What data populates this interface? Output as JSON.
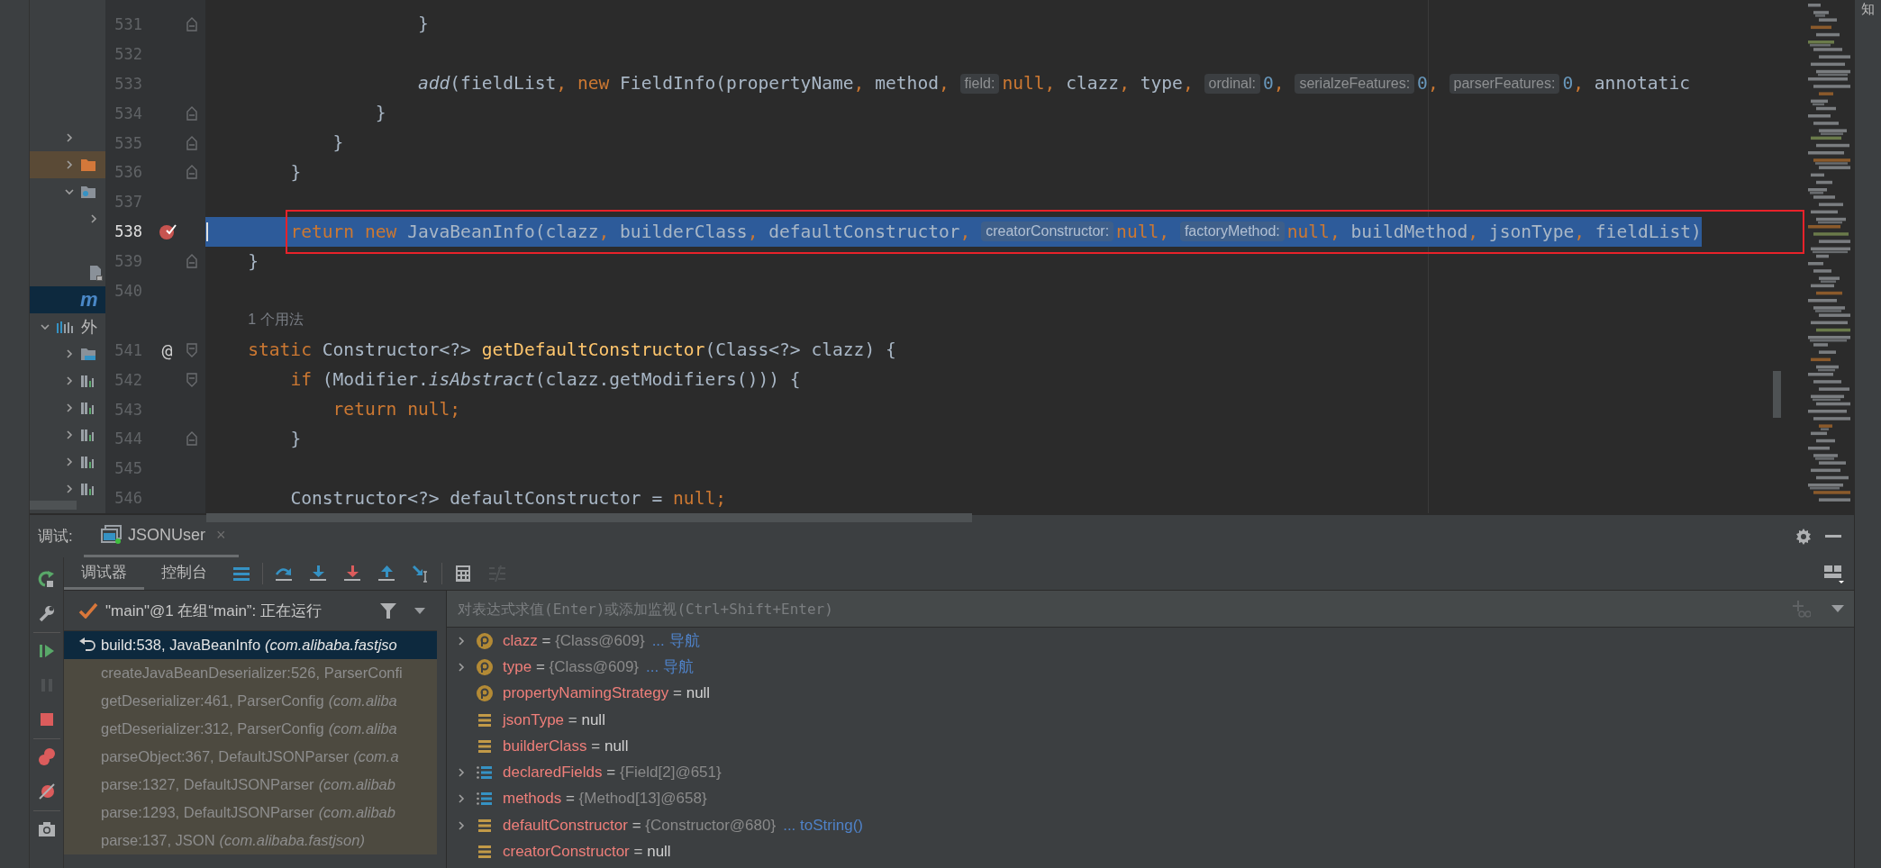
{
  "right_strip": {
    "label": "知"
  },
  "project_tree": {
    "items": [
      {
        "kind": "none",
        "expanded": false,
        "highlighted": false,
        "selected": false
      },
      {
        "kind": "folder-orange",
        "expanded": false,
        "highlighted": true,
        "selected": false
      },
      {
        "kind": "folder-dot",
        "expanded": true,
        "highlighted": false,
        "selected": false,
        "children": [
          {
            "kind": "none",
            "expanded": false,
            "highlighted": false,
            "selected": false
          },
          {
            "kind": "blank",
            "highlighted": false,
            "selected": false
          },
          {
            "kind": "file",
            "highlighted": false,
            "selected": false
          }
        ]
      },
      {
        "kind": "module",
        "label": "m",
        "highlighted": false,
        "selected": true
      }
    ],
    "external": {
      "label": "外",
      "expanded": true,
      "children": [
        {
          "kind": "folder-blue",
          "expanded": false
        },
        {
          "kind": "library",
          "expanded": false
        },
        {
          "kind": "library",
          "expanded": false
        },
        {
          "kind": "library",
          "expanded": false
        },
        {
          "kind": "library",
          "expanded": false
        },
        {
          "kind": "library",
          "expanded": false
        }
      ]
    }
  },
  "editor": {
    "lines": [
      {
        "kind": "code",
        "number": "531",
        "fold": {
          "kind": "end"
        },
        "current": false,
        "selected": false,
        "boxed": false,
        "tokens": [
          {
            "text": "                    }",
            "kind": "id"
          }
        ]
      },
      {
        "kind": "code",
        "number": "532",
        "current": false,
        "selected": false,
        "boxed": false
      },
      {
        "kind": "code",
        "number": "533",
        "current": false,
        "selected": false,
        "boxed": false,
        "tokens": [
          {
            "text": "                    add",
            "kind": "italic"
          },
          {
            "text": "(fieldList",
            "kind": "id"
          },
          {
            "text": ", ",
            "kind": "punct"
          },
          {
            "text": "new ",
            "kind": "kw"
          },
          {
            "text": "FieldInfo(propertyName",
            "kind": "id"
          },
          {
            "text": ", ",
            "kind": "punct"
          },
          {
            "text": "method",
            "kind": "id"
          },
          {
            "text": ", ",
            "kind": "punct"
          },
          {
            "text": "field:",
            "kind": "hint"
          },
          {
            "text": "null",
            "kind": "kw"
          },
          {
            "text": ", ",
            "kind": "punct"
          },
          {
            "text": "clazz",
            "kind": "id"
          },
          {
            "text": ", ",
            "kind": "punct"
          },
          {
            "text": "type",
            "kind": "id"
          },
          {
            "text": ", ",
            "kind": "punct"
          },
          {
            "text": "ordinal:",
            "kind": "hint"
          },
          {
            "text": "0",
            "kind": "num"
          },
          {
            "text": ", ",
            "kind": "punct"
          },
          {
            "text": "serialzeFeatures:",
            "kind": "hint"
          },
          {
            "text": "0",
            "kind": "num"
          },
          {
            "text": ", ",
            "kind": "punct"
          },
          {
            "text": "parserFeatures:",
            "kind": "hint"
          },
          {
            "text": "0",
            "kind": "num"
          },
          {
            "text": ", ",
            "kind": "punct"
          },
          {
            "text": "annotatic",
            "kind": "id"
          }
        ]
      },
      {
        "kind": "code",
        "number": "534",
        "fold": {
          "kind": "end"
        },
        "current": false,
        "selected": false,
        "boxed": false,
        "tokens": [
          {
            "text": "                }",
            "kind": "id"
          }
        ]
      },
      {
        "kind": "code",
        "number": "535",
        "fold": {
          "kind": "end"
        },
        "current": false,
        "selected": false,
        "boxed": false,
        "tokens": [
          {
            "text": "            }",
            "kind": "id"
          }
        ]
      },
      {
        "kind": "code",
        "number": "536",
        "fold": {
          "kind": "end"
        },
        "current": false,
        "selected": false,
        "boxed": false,
        "tokens": [
          {
            "text": "        }",
            "kind": "id"
          }
        ]
      },
      {
        "kind": "code",
        "number": "537",
        "current": false,
        "selected": false,
        "boxed": false
      },
      {
        "kind": "code",
        "number": "538",
        "marker": {
          "kind": "breakpoint"
        },
        "current": true,
        "selected": true,
        "boxed": true,
        "tokens": [
          {
            "text": "        return new ",
            "kind": "kw"
          },
          {
            "text": "JavaBeanInfo(clazz",
            "kind": "id"
          },
          {
            "text": ", ",
            "kind": "punct"
          },
          {
            "text": "builderClass",
            "kind": "id"
          },
          {
            "text": ", ",
            "kind": "punct"
          },
          {
            "text": "defaultConstructor",
            "kind": "id"
          },
          {
            "text": ", ",
            "kind": "punct"
          },
          {
            "text": "creatorConstructor:",
            "kind": "hint"
          },
          {
            "text": "null",
            "kind": "kw"
          },
          {
            "text": ", ",
            "kind": "punct"
          },
          {
            "text": "factoryMethod:",
            "kind": "hint"
          },
          {
            "text": "null",
            "kind": "kw"
          },
          {
            "text": ", ",
            "kind": "punct"
          },
          {
            "text": "buildMethod",
            "kind": "id"
          },
          {
            "text": ", ",
            "kind": "punct"
          },
          {
            "text": "jsonType",
            "kind": "id"
          },
          {
            "text": ", ",
            "kind": "punct"
          },
          {
            "text": "fieldList)",
            "kind": "id"
          }
        ]
      },
      {
        "kind": "code",
        "number": "539",
        "fold": {
          "kind": "end"
        },
        "current": false,
        "selected": false,
        "boxed": false,
        "tokens": [
          {
            "text": "    }",
            "kind": "id"
          }
        ]
      },
      {
        "kind": "code",
        "number": "540",
        "current": false,
        "selected": false,
        "boxed": false
      },
      {
        "kind": "usage",
        "tokens": [
          {
            "text": "    1 个用法",
            "kind": "usage"
          }
        ]
      },
      {
        "kind": "code",
        "number": "541",
        "marker": {
          "kind": "glyph",
          "text": "@"
        },
        "fold": {
          "kind": "start"
        },
        "current": false,
        "selected": false,
        "boxed": false,
        "tokens": [
          {
            "text": "    static ",
            "kind": "kw"
          },
          {
            "text": "Constructor<?> ",
            "kind": "id"
          },
          {
            "text": "getDefaultConstructor",
            "kind": "fn"
          },
          {
            "text": "(Class<?> clazz) {",
            "kind": "id"
          }
        ]
      },
      {
        "kind": "code",
        "number": "542",
        "fold": {
          "kind": "start"
        },
        "current": false,
        "selected": false,
        "boxed": false,
        "tokens": [
          {
            "text": "        if ",
            "kind": "kw"
          },
          {
            "text": "(Modifier.",
            "kind": "id"
          },
          {
            "text": "isAbstract",
            "kind": "italic"
          },
          {
            "text": "(clazz.getModifiers())) {",
            "kind": "id"
          }
        ]
      },
      {
        "kind": "code",
        "number": "543",
        "current": false,
        "selected": false,
        "boxed": false,
        "tokens": [
          {
            "text": "            return null",
            "kind": "kw"
          },
          {
            "text": ";",
            "kind": "punct"
          }
        ]
      },
      {
        "kind": "code",
        "number": "544",
        "fold": {
          "kind": "end"
        },
        "current": false,
        "selected": false,
        "boxed": false,
        "tokens": [
          {
            "text": "        }",
            "kind": "id"
          }
        ]
      },
      {
        "kind": "code",
        "number": "545",
        "current": false,
        "selected": false,
        "boxed": false
      },
      {
        "kind": "code",
        "number": "546",
        "current": false,
        "selected": false,
        "boxed": false,
        "tokens": [
          {
            "text": "        Constructor<?> defaultConstructor = ",
            "kind": "id"
          },
          {
            "text": "null",
            "kind": "kw"
          },
          {
            "text": ";",
            "kind": "punct"
          }
        ]
      }
    ]
  },
  "debug": {
    "label": "调试:",
    "session_tab": {
      "label": "JSONUser",
      "close": "×",
      "selected": true
    },
    "side_toolbar": [
      {
        "kind": "rerun",
        "disabled": false
      },
      {
        "kind": "settings",
        "disabled": false
      },
      {
        "kind": "separator",
        "disabled": false
      },
      {
        "kind": "resume",
        "disabled": false
      },
      {
        "kind": "pause",
        "disabled": true
      },
      {
        "kind": "stop",
        "disabled": false
      },
      {
        "kind": "separator",
        "disabled": false
      },
      {
        "kind": "breakpoints",
        "disabled": false
      },
      {
        "kind": "mute",
        "disabled": false
      },
      {
        "kind": "separator",
        "disabled": false
      },
      {
        "kind": "camera",
        "disabled": false
      }
    ],
    "tabs": [
      {
        "label": "调试器",
        "selected": true
      },
      {
        "label": "控制台",
        "selected": false
      }
    ],
    "tools": [
      {
        "kind": "frames-layout",
        "disabled": false
      },
      {
        "kind": "separator",
        "disabled": false
      },
      {
        "kind": "step-over",
        "disabled": false
      },
      {
        "kind": "step-into",
        "disabled": false
      },
      {
        "kind": "force-step-into",
        "disabled": false
      },
      {
        "kind": "step-out",
        "disabled": false
      },
      {
        "kind": "run-to-cursor",
        "disabled": false
      },
      {
        "kind": "separator",
        "disabled": false
      },
      {
        "kind": "evaluate",
        "disabled": false
      },
      {
        "kind": "trace",
        "disabled": true
      }
    ],
    "thread": {
      "label": "\"main\"@1 在组“main”: 正在运行"
    },
    "frames": [
      {
        "name": "build:538, JavaBeanInfo",
        "location": "(com.alibaba.fastjso",
        "selected": true,
        "library": false
      },
      {
        "name": "createJavaBeanDeserializer:526, ParserConfi",
        "selected": false,
        "library": true
      },
      {
        "name": "getDeserializer:461, ParserConfig",
        "location": "(com.aliba",
        "selected": false,
        "library": true
      },
      {
        "name": "getDeserializer:312, ParserConfig",
        "location": "(com.aliba",
        "selected": false,
        "library": true
      },
      {
        "name": "parseObject:367, DefaultJSONParser",
        "location": "(com.a",
        "selected": false,
        "library": true
      },
      {
        "name": "parse:1327, DefaultJSONParser",
        "location": "(com.alibab",
        "selected": false,
        "library": true
      },
      {
        "name": "parse:1293, DefaultJSONParser",
        "location": "(com.alibab",
        "selected": false,
        "library": true
      },
      {
        "name": "parse:137, JSON",
        "location": "(com.alibaba.fastjson)",
        "selected": false,
        "library": true
      }
    ],
    "expression": {
      "placeholder": "对表达式求值(Enter)或添加监视(Ctrl+Shift+Enter)"
    },
    "variables": [
      {
        "kind": "property",
        "name": "clazz",
        "equals": "=",
        "value": "{Class@609}",
        "link": "... 导航",
        "expanded": false
      },
      {
        "kind": "property",
        "name": "type",
        "equals": "=",
        "value": "{Class@609}",
        "link": "... 导航",
        "expanded": false
      },
      {
        "kind": "property",
        "name": "propertyNamingStrategy",
        "equals": "=",
        "value": "null"
      },
      {
        "kind": "field",
        "name": "jsonType",
        "equals": "=",
        "value": "null"
      },
      {
        "kind": "field",
        "name": "builderClass",
        "equals": "=",
        "value": "null"
      },
      {
        "kind": "array",
        "name": "declaredFields",
        "equals": "=",
        "value": "{Field[2]@651}",
        "expanded": false
      },
      {
        "kind": "array",
        "name": "methods",
        "equals": "=",
        "value": "{Method[13]@658}",
        "expanded": false
      },
      {
        "kind": "field",
        "name": "defaultConstructor",
        "equals": "=",
        "value": "{Constructor@680}",
        "link": "... toString()",
        "expanded": false
      },
      {
        "kind": "field",
        "name": "creatorConstructor",
        "equals": "=",
        "value": "null"
      }
    ]
  }
}
